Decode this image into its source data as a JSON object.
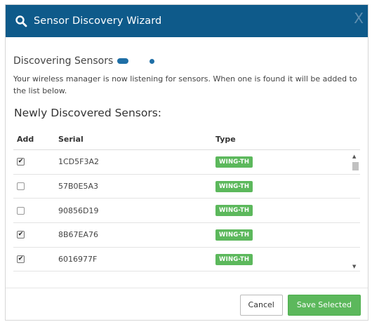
{
  "header": {
    "title": "Sensor Discovery Wizard",
    "icon": "search-icon",
    "close_label": "X",
    "background": "#0e5a8a"
  },
  "status": {
    "label": "Discovering Sensors",
    "description": "Your wireless manager is now listening for sensors. When one is found it will be added to the list below."
  },
  "section_title": "Newly Discovered Sensors:",
  "table": {
    "columns": [
      "Add",
      "Serial",
      "Type"
    ],
    "rows": [
      {
        "checked": true,
        "serial": "1CD5F3A2",
        "type": "WING-TH"
      },
      {
        "checked": false,
        "serial": "57B0E5A3",
        "type": "WING-TH"
      },
      {
        "checked": false,
        "serial": "90856D19",
        "type": "WING-TH"
      },
      {
        "checked": true,
        "serial": "8B67EA76",
        "type": "WING-TH"
      },
      {
        "checked": true,
        "serial": "6016977F",
        "type": "WING-TH"
      }
    ]
  },
  "footer": {
    "cancel_label": "Cancel",
    "save_label": "Save Selected",
    "save_color": "#5cb85c"
  }
}
